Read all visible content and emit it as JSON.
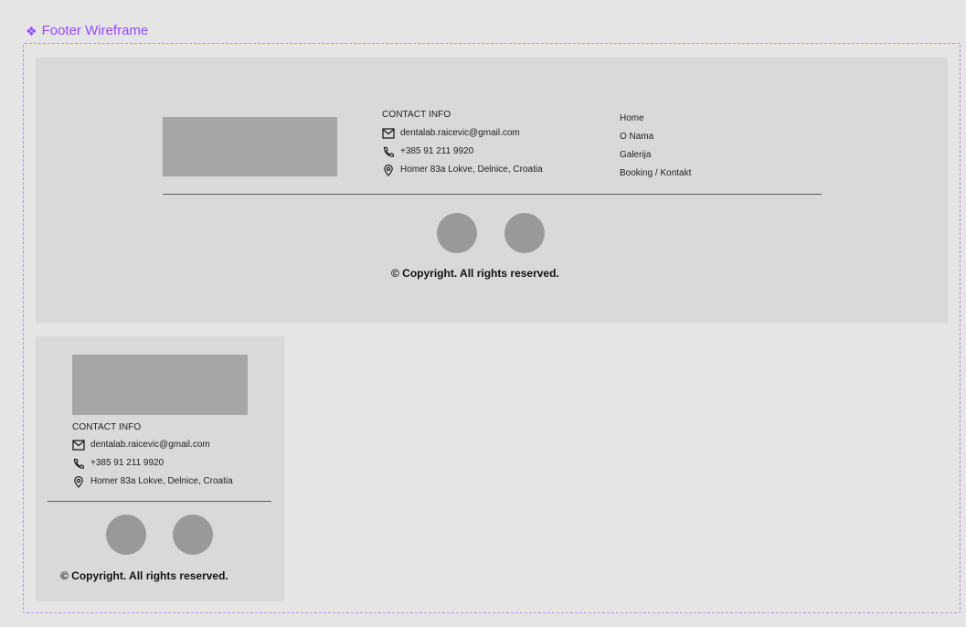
{
  "frame": {
    "title": "Footer Wireframe",
    "title_glyph": "❖",
    "accent_color": "#9747ff"
  },
  "desktop_footer": {
    "contact": {
      "title": "CONTACT INFO",
      "email": "dentalab.raicevic@gmail.com",
      "phone": "+385 91 211 9920",
      "address": "Homer 83a Lokve, Delnice, Croatia"
    },
    "nav": [
      "Home",
      "O Nama",
      "Galerija",
      "Booking / Kontakt"
    ],
    "copyright": "© Copyright. All rights reserved."
  },
  "mobile_footer": {
    "contact": {
      "title": "CONTACT INFO",
      "email": "dentalab.raicevic@gmail.com",
      "phone": "+385 91 211 9920",
      "address": "Homer 83a Lokve, Delnice, Croatia"
    },
    "copyright": "© Copyright. All rights reserved."
  },
  "icons": {
    "email": "mail-icon",
    "phone": "phone-icon",
    "address": "location-pin-icon"
  }
}
